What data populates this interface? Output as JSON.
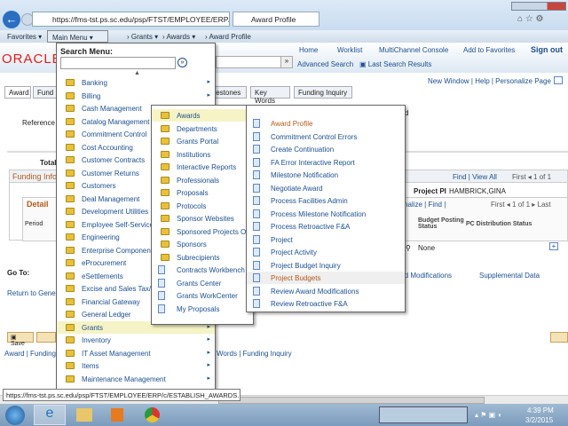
{
  "browser": {
    "url": "https://fms-tst.ps.sc.edu/psp/FTST/EMPLOYEE/ERP/c/MANA",
    "tab_title": "Award Profile"
  },
  "nav": {
    "favorites": "Favorites",
    "main_menu": "Main Menu",
    "breadcrumb": [
      "Grants",
      "Awards",
      "Award Profile"
    ]
  },
  "header": {
    "logo": "ORACLE",
    "links": [
      "Home",
      "Worklist",
      "MultiChannel Console",
      "Add to Favorites",
      "Sign out"
    ],
    "advanced_search": "Advanced Search",
    "last_search": "Last Search Results"
  },
  "page": {
    "top_links": "New Window | Help | Personalize Page",
    "tabs": [
      "Award",
      "Fund",
      "Milestones",
      "Key Words",
      "Funding Inquiry"
    ],
    "reference": "Reference",
    "total": "Total",
    "funding_info": "Funding Info",
    "find_view_all": "Find | View All",
    "first": "First",
    "one_of_one": "1 of 1",
    "project_pi_label": "Project PI",
    "project_pi": "HAMBRICK,GINA",
    "grid_nav": "nalize | Find |",
    "last": "Last",
    "detail": "Detail",
    "period": "Period",
    "budget_posting_status": "Budget Posting Status",
    "pc_distribution_status": "PC Distribution Status",
    "none": "None",
    "go_to": "Go To:",
    "award_mods": "rd Modifications",
    "supplemental": "Supplemental Data",
    "return": "Return to Genera",
    "save": "Save",
    "bottom_links_left": "Award | Funding |",
    "bottom_links_right": "Words | Funding Inquiry",
    "d_trunc": "d"
  },
  "main_menu": {
    "search_label": "Search Menu:",
    "items": [
      "Banking",
      "Billing",
      "Cash Management",
      "Catalog Management",
      "Commitment Control",
      "Cost Accounting",
      "Customer Contracts",
      "Customer Returns",
      "Customers",
      "Deal Management",
      "Development Utilities",
      "Employee Self-Service",
      "Engineering",
      "Enterprise Components",
      "eProcurement",
      "eSettlements",
      "Excise and Sales Tax/V",
      "Financial Gateway",
      "General Ledger",
      "Grants",
      "Inventory",
      "IT Asset Management",
      "Items",
      "Maintenance Management"
    ]
  },
  "grants_menu": {
    "folders": [
      "Awards",
      "Departments",
      "Grants Portal",
      "Institutions",
      "Interactive Reports",
      "Professionals",
      "Proposals",
      "Protocols",
      "Sponsor Websites",
      "Sponsored Projects Offi",
      "Sponsors",
      "Subrecipients"
    ],
    "pages": [
      "Contracts Workbench",
      "Grants Center",
      "Grants WorkCenter",
      "My Proposals"
    ]
  },
  "awards_menu": {
    "items": [
      "Award Profile",
      "Commitment Control Errors",
      "Create Continuation",
      "FA Error Interactive Report",
      "Milestone Notification",
      "Negotiate Award",
      "Process Facilities Admin",
      "Process Milestone Notification",
      "Process Retroactive F&A",
      "Project",
      "Project Activity",
      "Project Budget Inquiry",
      "Project Budgets",
      "Review Award Modifications",
      "Review Retroactive F&A"
    ]
  },
  "status_tooltip": "https://fms-tst.ps.sc.edu/psp/FTST/EMPLOYEE/ERP/c/ESTABLISH_AWARDS...",
  "taskbar": {
    "time": "4:39 PM",
    "date": "3/2/2015"
  }
}
